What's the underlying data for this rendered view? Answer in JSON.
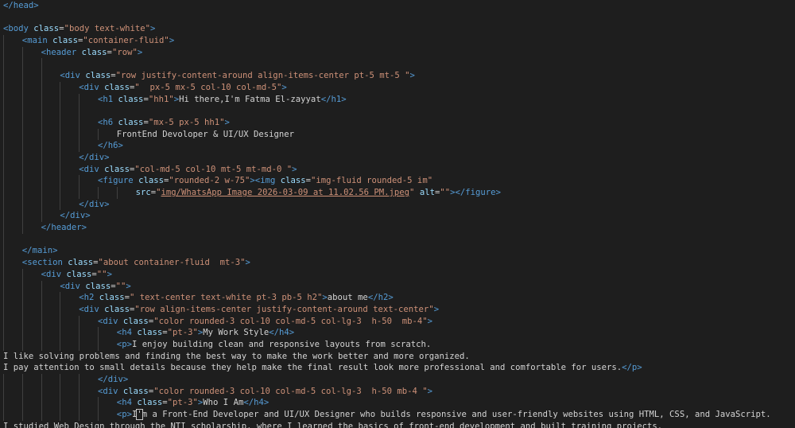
{
  "editor": {
    "theme": {
      "background": "#1e1e1e",
      "tag": "#569cd6",
      "attr": "#9cdcfe",
      "string": "#ce9178",
      "text": "#d4d4d4",
      "guide": "#404040"
    },
    "lines": [
      {
        "indent": 0,
        "segs": [
          [
            "tag",
            "</"
          ],
          [
            "tag",
            "head"
          ],
          [
            "tag",
            ">"
          ]
        ]
      },
      {
        "indent": 0,
        "segs": []
      },
      {
        "indent": 0,
        "segs": [
          [
            "tag",
            "<"
          ],
          [
            "tag",
            "body"
          ],
          [
            "txt",
            " "
          ],
          [
            "attr",
            "class"
          ],
          [
            "txt",
            "="
          ],
          [
            "str",
            "\"body text-white\""
          ],
          [
            "tag",
            ">"
          ]
        ]
      },
      {
        "indent": 1,
        "segs": [
          [
            "tag",
            "<"
          ],
          [
            "tag",
            "main"
          ],
          [
            "txt",
            " "
          ],
          [
            "attr",
            "class"
          ],
          [
            "txt",
            "="
          ],
          [
            "str",
            "\"container-fluid\""
          ],
          [
            "tag",
            ">"
          ]
        ]
      },
      {
        "indent": 2,
        "segs": [
          [
            "tag",
            "<"
          ],
          [
            "tag",
            "header"
          ],
          [
            "txt",
            " "
          ],
          [
            "attr",
            "class"
          ],
          [
            "txt",
            "="
          ],
          [
            "str",
            "\"row\""
          ],
          [
            "tag",
            ">"
          ]
        ]
      },
      {
        "indent": 3,
        "segs": []
      },
      {
        "indent": 3,
        "segs": [
          [
            "tag",
            "<"
          ],
          [
            "tag",
            "div"
          ],
          [
            "txt",
            " "
          ],
          [
            "attr",
            "class"
          ],
          [
            "txt",
            "="
          ],
          [
            "str",
            "\"row justify-content-around align-items-center pt-5 mt-5 \""
          ],
          [
            "tag",
            ">"
          ]
        ]
      },
      {
        "indent": 4,
        "segs": [
          [
            "tag",
            "<"
          ],
          [
            "tag",
            "div"
          ],
          [
            "txt",
            " "
          ],
          [
            "attr",
            "class"
          ],
          [
            "txt",
            "="
          ],
          [
            "str",
            "\"  px-5 mx-5 col-10 col-md-5\""
          ],
          [
            "tag",
            ">"
          ]
        ]
      },
      {
        "indent": 5,
        "segs": [
          [
            "tag",
            "<"
          ],
          [
            "tag",
            "h1"
          ],
          [
            "txt",
            " "
          ],
          [
            "attr",
            "class"
          ],
          [
            "txt",
            "="
          ],
          [
            "str",
            "\"hh1\""
          ],
          [
            "tag",
            ">"
          ],
          [
            "txt",
            "Hi there,I'm Fatma El-zayyat"
          ],
          [
            "tag",
            "</"
          ],
          [
            "tag",
            "h1"
          ],
          [
            "tag",
            ">"
          ]
        ]
      },
      {
        "indent": 5,
        "segs": []
      },
      {
        "indent": 5,
        "segs": [
          [
            "tag",
            "<"
          ],
          [
            "tag",
            "h6"
          ],
          [
            "txt",
            " "
          ],
          [
            "attr",
            "class"
          ],
          [
            "txt",
            "="
          ],
          [
            "str",
            "\"mx-5 px-5 hh1\""
          ],
          [
            "tag",
            ">"
          ]
        ]
      },
      {
        "indent": 6,
        "segs": [
          [
            "txt",
            "FrontEnd Devoloper & UI/UX Designer"
          ]
        ]
      },
      {
        "indent": 5,
        "segs": [
          [
            "tag",
            "</"
          ],
          [
            "tag",
            "h6"
          ],
          [
            "tag",
            ">"
          ]
        ]
      },
      {
        "indent": 4,
        "segs": [
          [
            "tag",
            "</"
          ],
          [
            "tag",
            "div"
          ],
          [
            "tag",
            ">"
          ]
        ]
      },
      {
        "indent": 4,
        "segs": [
          [
            "tag",
            "<"
          ],
          [
            "tag",
            "div"
          ],
          [
            "txt",
            " "
          ],
          [
            "attr",
            "class"
          ],
          [
            "txt",
            "="
          ],
          [
            "str",
            "\"col-md-5 col-10 mt-5 mt-md-0 \""
          ],
          [
            "tag",
            ">"
          ]
        ]
      },
      {
        "indent": 5,
        "segs": [
          [
            "tag",
            "<"
          ],
          [
            "tag",
            "figure"
          ],
          [
            "txt",
            " "
          ],
          [
            "attr",
            "class"
          ],
          [
            "txt",
            "="
          ],
          [
            "str",
            "\"rounded-2 w-75\""
          ],
          [
            "tag",
            ">"
          ],
          [
            "tag",
            "<"
          ],
          [
            "tag",
            "img"
          ],
          [
            "txt",
            " "
          ],
          [
            "attr",
            "class"
          ],
          [
            "txt",
            "="
          ],
          [
            "str",
            "\"img-fluid rounded-5 im\""
          ]
        ]
      },
      {
        "indent": 7,
        "segs": [
          [
            "attr",
            "src"
          ],
          [
            "txt",
            "="
          ],
          [
            "str",
            "\""
          ],
          [
            "link",
            "img/WhatsApp Image 2026-03-09 at 11.02.56 PM.jpeg"
          ],
          [
            "str",
            "\""
          ],
          [
            "txt",
            " "
          ],
          [
            "attr",
            "alt"
          ],
          [
            "txt",
            "="
          ],
          [
            "str",
            "\"\""
          ],
          [
            "tag",
            ">"
          ],
          [
            "tag",
            "</"
          ],
          [
            "tag",
            "figure"
          ],
          [
            "tag",
            ">"
          ]
        ]
      },
      {
        "indent": 4,
        "segs": [
          [
            "tag",
            "</"
          ],
          [
            "tag",
            "div"
          ],
          [
            "tag",
            ">"
          ]
        ]
      },
      {
        "indent": 3,
        "segs": [
          [
            "tag",
            "</"
          ],
          [
            "tag",
            "div"
          ],
          [
            "tag",
            ">"
          ]
        ]
      },
      {
        "indent": 2,
        "segs": [
          [
            "tag",
            "</"
          ],
          [
            "tag",
            "header"
          ],
          [
            "tag",
            ">"
          ]
        ]
      },
      {
        "indent": 1,
        "segs": []
      },
      {
        "indent": 1,
        "segs": [
          [
            "tag",
            "</"
          ],
          [
            "tag",
            "main"
          ],
          [
            "tag",
            ">"
          ]
        ]
      },
      {
        "indent": 1,
        "segs": [
          [
            "tag",
            "<"
          ],
          [
            "tag",
            "section"
          ],
          [
            "txt",
            " "
          ],
          [
            "attr",
            "class"
          ],
          [
            "txt",
            "="
          ],
          [
            "str",
            "\"about container-fluid  mt-3\""
          ],
          [
            "tag",
            ">"
          ]
        ]
      },
      {
        "indent": 2,
        "segs": [
          [
            "tag",
            "<"
          ],
          [
            "tag",
            "div"
          ],
          [
            "txt",
            " "
          ],
          [
            "attr",
            "class"
          ],
          [
            "txt",
            "="
          ],
          [
            "str",
            "\"\""
          ],
          [
            "tag",
            ">"
          ]
        ]
      },
      {
        "indent": 3,
        "segs": [
          [
            "tag",
            "<"
          ],
          [
            "tag",
            "div"
          ],
          [
            "txt",
            " "
          ],
          [
            "attr",
            "class"
          ],
          [
            "txt",
            "="
          ],
          [
            "str",
            "\"\""
          ],
          [
            "tag",
            ">"
          ]
        ]
      },
      {
        "indent": 4,
        "segs": [
          [
            "tag",
            "<"
          ],
          [
            "tag",
            "h2"
          ],
          [
            "txt",
            " "
          ],
          [
            "attr",
            "class"
          ],
          [
            "txt",
            "="
          ],
          [
            "str",
            "\" text-center text-white pt-3 pb-5 h2\""
          ],
          [
            "tag",
            ">"
          ],
          [
            "txt",
            "about me"
          ],
          [
            "tag",
            "</"
          ],
          [
            "tag",
            "h2"
          ],
          [
            "tag",
            ">"
          ]
        ]
      },
      {
        "indent": 4,
        "segs": [
          [
            "tag",
            "<"
          ],
          [
            "tag",
            "div"
          ],
          [
            "txt",
            " "
          ],
          [
            "attr",
            "class"
          ],
          [
            "txt",
            "="
          ],
          [
            "str",
            "\"row align-items-center justify-content-around text-center\""
          ],
          [
            "tag",
            ">"
          ]
        ]
      },
      {
        "indent": 5,
        "segs": [
          [
            "tag",
            "<"
          ],
          [
            "tag",
            "div"
          ],
          [
            "txt",
            " "
          ],
          [
            "attr",
            "class"
          ],
          [
            "txt",
            "="
          ],
          [
            "str",
            "\"color rounded-3 col-10 col-md-5 col-lg-3  h-50  mb-4\""
          ],
          [
            "tag",
            ">"
          ]
        ]
      },
      {
        "indent": 6,
        "segs": [
          [
            "tag",
            "<"
          ],
          [
            "tag",
            "h4"
          ],
          [
            "txt",
            " "
          ],
          [
            "attr",
            "class"
          ],
          [
            "txt",
            "="
          ],
          [
            "str",
            "\"pt-3\""
          ],
          [
            "tag",
            ">"
          ],
          [
            "txt",
            "My Work Style"
          ],
          [
            "tag",
            "</"
          ],
          [
            "tag",
            "h4"
          ],
          [
            "tag",
            ">"
          ]
        ]
      },
      {
        "indent": 6,
        "segs": [
          [
            "tag",
            "<"
          ],
          [
            "tag",
            "p"
          ],
          [
            "tag",
            ">"
          ],
          [
            "txt",
            "I enjoy building clean and responsive layouts from scratch."
          ]
        ]
      },
      {
        "indent": 0,
        "segs": [
          [
            "txt",
            "I like solving problems and finding the best way to make the work better and more organized."
          ]
        ]
      },
      {
        "indent": 0,
        "segs": [
          [
            "txt",
            "I pay attention to small details because they help make the final result look more professional and comfortable for users."
          ],
          [
            "tag",
            "</"
          ],
          [
            "tag",
            "p"
          ],
          [
            "tag",
            ">"
          ]
        ]
      },
      {
        "indent": 5,
        "segs": [
          [
            "tag",
            "</"
          ],
          [
            "tag",
            "div"
          ],
          [
            "tag",
            ">"
          ]
        ]
      },
      {
        "indent": 5,
        "segs": [
          [
            "tag",
            "<"
          ],
          [
            "tag",
            "div"
          ],
          [
            "txt",
            " "
          ],
          [
            "attr",
            "class"
          ],
          [
            "txt",
            "="
          ],
          [
            "str",
            "\"color rounded-3 col-10 col-md-5 col-lg-3  h-50 mb-4 \""
          ],
          [
            "tag",
            ">"
          ]
        ]
      },
      {
        "indent": 6,
        "segs": [
          [
            "tag",
            "<"
          ],
          [
            "tag",
            "h4"
          ],
          [
            "txt",
            " "
          ],
          [
            "attr",
            "class"
          ],
          [
            "txt",
            "="
          ],
          [
            "str",
            "\"pt-3\""
          ],
          [
            "tag",
            ">"
          ],
          [
            "txt",
            "Who I Am"
          ],
          [
            "tag",
            "</"
          ],
          [
            "tag",
            "h4"
          ],
          [
            "tag",
            ">"
          ]
        ]
      },
      {
        "indent": 6,
        "segs": [
          [
            "tag",
            "<"
          ],
          [
            "tag",
            "p"
          ],
          [
            "tag",
            ">"
          ],
          [
            "txt",
            "I"
          ],
          [
            "cursor",
            "'"
          ],
          [
            "txt",
            "m a Front-End Developer and UI/UX Designer who builds responsive and user-friendly websites using HTML, CSS, and JavaScript."
          ]
        ]
      },
      {
        "indent": 0,
        "segs": [
          [
            "txt",
            "I studied Web Design through the NTI scholarship, where I learned the basics of front-end development and built training projects."
          ]
        ]
      }
    ]
  }
}
